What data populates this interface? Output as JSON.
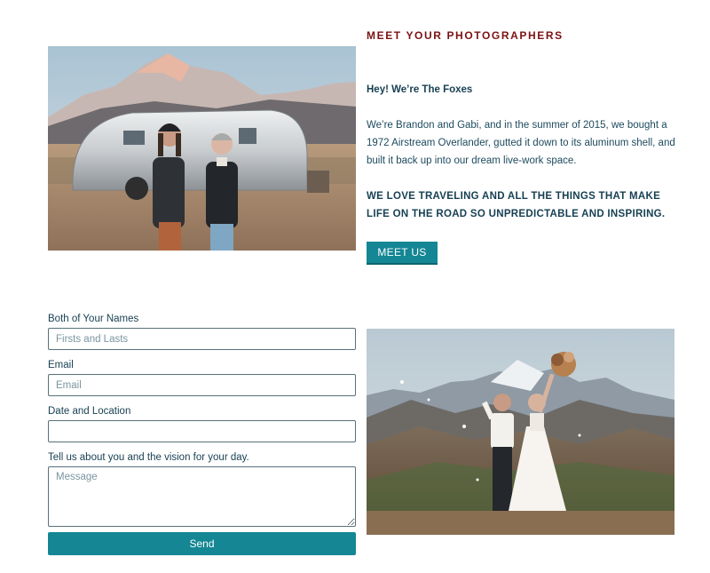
{
  "intro": {
    "eyebrow": "MEET YOUR PHOTOGRAPHERS",
    "heading": "Hey! We’re The Foxes",
    "body": "We’re Brandon and Gabi, and in the summer of 2015, we bought a 1972 Airstream Overlander, gutted it down to its aluminum shell, and built it back up into our dream live-work space.",
    "callout": "WE LOVE TRAVELING AND ALL THE THINGS THAT MAKE LIFE ON THE ROAD SO UNPREDICTABLE AND INSPIRING.",
    "button_label": "MEET US"
  },
  "photos": {
    "top": "couple-with-airstream-photo",
    "bottom": "wedding-couple-mountain-photo"
  },
  "form": {
    "names": {
      "label": "Both of Your Names",
      "placeholder": "Firsts and Lasts",
      "value": ""
    },
    "email": {
      "label": "Email",
      "placeholder": "Email",
      "value": ""
    },
    "date_location": {
      "label": "Date and Location",
      "placeholder": "",
      "value": ""
    },
    "message": {
      "label": "Tell us about you and the vision for your day.",
      "placeholder": "Message",
      "value": ""
    },
    "send_label": "Send"
  },
  "colors": {
    "accent": "#148694",
    "eyebrow": "#7b1212",
    "text": "#163f52"
  }
}
